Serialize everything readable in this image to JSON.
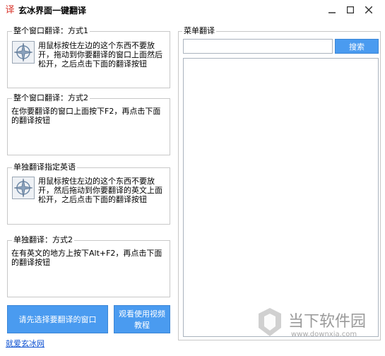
{
  "window": {
    "title": "玄冰界面一键翻译"
  },
  "groups": [
    {
      "label": "整个窗口翻译：方式1",
      "text": "用鼠标按住左边的这个东西不要放开，拖动到你要翻译的窗口上面然后松开，之后点击下面的翻译按钮"
    },
    {
      "label": "整个窗口翻译：方式2",
      "text": "在你要翻译的窗口上面按下F2，再点击下面的翻译按钮"
    },
    {
      "label": "单独翻译指定英语",
      "text": "用鼠标按住左边的这个东西不要放开，然后拖动到你要翻译的英文上面松开，之后点击下面的翻译按钮"
    },
    {
      "label": "单独翻译：方式2",
      "text": "在有英文的地方上按下Alt+F2，再点击下面的翻译按钮"
    }
  ],
  "buttons": {
    "select_window": "请先选择要翻译的窗口",
    "watch_video": "观看使用视频教程",
    "search": "搜索"
  },
  "menu_translate": {
    "label": "菜单翻译",
    "search_value": ""
  },
  "footer_link": "就爱玄冰网",
  "watermark": {
    "main": "当下软件园",
    "sub": "www.downxia.com"
  },
  "colors": {
    "accent": "#4a9bf0",
    "link": "#0b4fd1",
    "title_icon": "#d9342b"
  }
}
